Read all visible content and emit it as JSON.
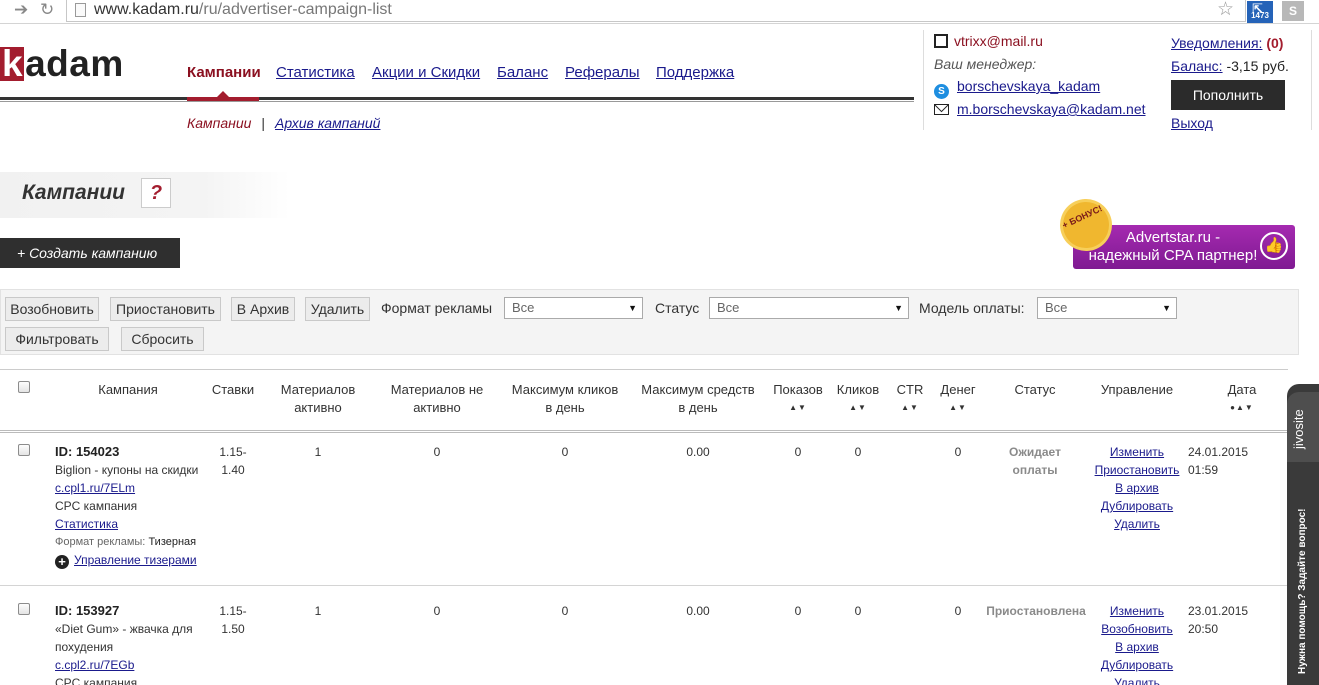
{
  "browser": {
    "url_domain": "www.kadam.ru",
    "url_path": "/ru/advertiser-campaign-list",
    "ext_badge": "1473",
    "ext2": "S"
  },
  "header": {
    "logo_k": "k",
    "logo_rest": "adam",
    "nav": [
      "Кампании",
      "Статистика",
      "Акции и Скидки",
      "Баланс",
      "Рефералы",
      "Поддержка"
    ],
    "subnav_current": "Кампании",
    "subnav_sep": "|",
    "subnav_archive": "Архив кампаний"
  },
  "account": {
    "email": "vtrixx@mail.ru",
    "manager_label": "Ваш менеджер:",
    "manager_skype": "borschevskaya_kadam",
    "manager_email": "m.borschevskaya@kadam.net",
    "notifications_label": "Уведомления:",
    "notifications_count": "(0)",
    "balance_label": "Баланс:",
    "balance_value": "-3,15 руб.",
    "topup": "Пополнить",
    "logout": "Выход"
  },
  "page": {
    "title": "Кампании",
    "help": "?",
    "create_button": "+ Создать кампанию"
  },
  "banner": {
    "bonus": "+ БОНУС!",
    "line1": "Advertstar.ru -",
    "line2": "надежный CPA партнер!"
  },
  "filters": {
    "resume": "Возобновить",
    "pause": "Приостановить",
    "archive": "В Архив",
    "delete": "Удалить",
    "format_label": "Формат рекламы",
    "format_value": "Все",
    "status_label": "Статус",
    "status_value": "Все",
    "payment_label": "Модель оплаты:",
    "payment_value": "Все",
    "apply": "Фильтровать",
    "reset": "Сбросить"
  },
  "table": {
    "headers": {
      "campaign": "Кампания",
      "bids": "Ставки",
      "active_l1": "Материалов",
      "active_l2": "активно",
      "inactive_l1": "Материалов не",
      "inactive_l2": "активно",
      "maxclicks_l1": "Максимум кликов",
      "maxclicks_l2": "в день",
      "maxfunds_l1": "Максимум средств",
      "maxfunds_l2": "в день",
      "impressions": "Показов",
      "clicks": "Кликов",
      "ctr": "CTR",
      "money": "Денег",
      "status": "Статус",
      "manage": "Управление",
      "date": "Дата"
    },
    "rows": [
      {
        "id": "ID: 154023",
        "name": "Biglion - купоны на скидки",
        "url": "c.cpl1.ru/7ELm",
        "type": "CPC кампания",
        "stats": "Статистика",
        "format_label": "Формат рекламы:",
        "format_value": "Тизерная",
        "teasers": "Управление тизерами",
        "bid_l1": "1.15-",
        "bid_l2": "1.40",
        "active": "1",
        "inactive": "0",
        "max_clicks": "0",
        "max_funds": "0.00",
        "impressions": "0",
        "clicks": "0",
        "money": "0",
        "status_l1": "Ожидает",
        "status_l2": "оплаты",
        "act1": "Изменить",
        "act2": "Приостановить",
        "act3": "В архив",
        "act4": "Дублировать",
        "act5": "Удалить",
        "date": "24.01.2015",
        "time": "01:59"
      },
      {
        "id": "ID: 153927",
        "name_l1": "«Diet Gum» - жвачка для",
        "name_l2": "похудения",
        "url": "c.cpl2.ru/7EGb",
        "type": "CPC кампания",
        "bid_l1": "1.15-",
        "bid_l2": "1.50",
        "active": "1",
        "inactive": "0",
        "max_clicks": "0",
        "max_funds": "0.00",
        "impressions": "0",
        "clicks": "0",
        "money": "0",
        "status": "Приостановлена",
        "act1": "Изменить",
        "act2": "Возобновить",
        "act3": "В архив",
        "act4": "Дублировать",
        "act5": "Удалить",
        "date": "23.01.2015",
        "time": "20:50"
      }
    ]
  },
  "jivo": {
    "brand": "jivosite",
    "ask": "Нужна помощь? Задайте вопрос!"
  }
}
